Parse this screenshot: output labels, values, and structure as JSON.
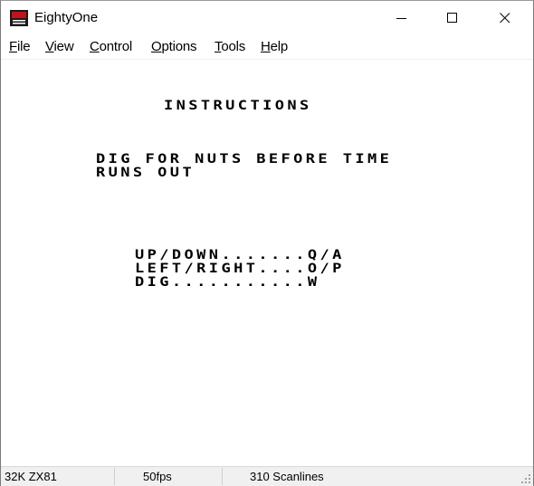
{
  "window": {
    "title": "EightyOne",
    "controls": {
      "minimize": "minimize",
      "maximize": "maximize",
      "close": "close"
    }
  },
  "menu": {
    "items": [
      {
        "first": "F",
        "rest": "ile"
      },
      {
        "first": "V",
        "rest": "iew"
      },
      {
        "first": "C",
        "rest": "ontrol"
      },
      {
        "first": "O",
        "rest": "ptions"
      },
      {
        "first": "T",
        "rest": "ools"
      },
      {
        "first": "H",
        "rest": "elp"
      }
    ]
  },
  "screen": {
    "title": "INSTRUCTIONS",
    "message_line1": "DIG FOR NUTS BEFORE TIME",
    "message_line2": "RUNS OUT",
    "keys_line1": "UP/DOWN.......Q/A",
    "keys_line2": "LEFT/RIGHT....O/P",
    "keys_line3": "DIG...........W"
  },
  "status": {
    "model": "32K ZX81",
    "fps": "50fps",
    "scanlines": "310 Scanlines"
  },
  "colors": {
    "screen_bg": "#ffffff",
    "screen_ink": "#000000",
    "statusbar_bg": "#f0f0f0",
    "icon_red": "#c0141c"
  },
  "icons": {
    "app": "zx81-computer-icon",
    "minimize": "minimize-icon",
    "maximize": "maximize-icon",
    "close": "close-icon",
    "grip": "resize-grip-icon"
  }
}
